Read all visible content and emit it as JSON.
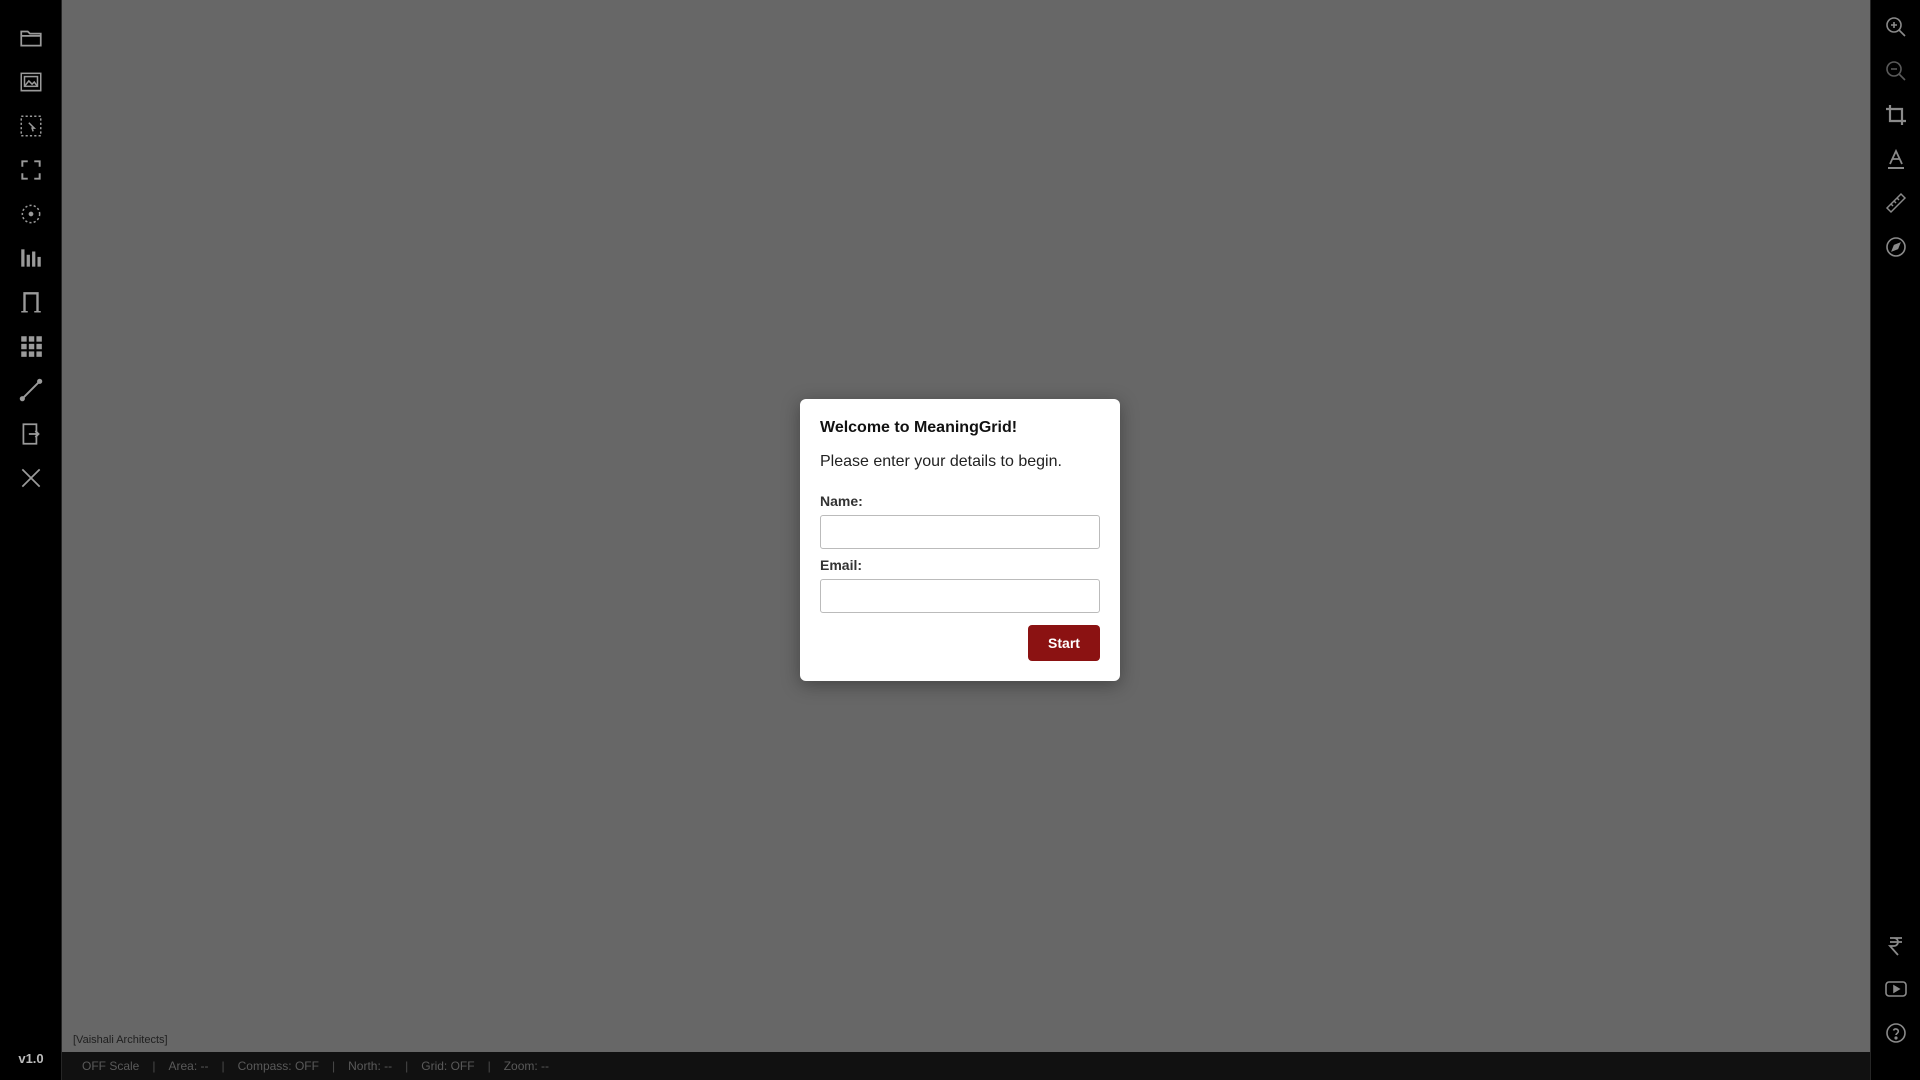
{
  "app": {
    "version": "v1.0"
  },
  "left_tools": [
    {
      "name": "open-folder-icon"
    },
    {
      "name": "gallery-icon"
    },
    {
      "name": "select-region-icon"
    },
    {
      "name": "fullscreen-icon"
    },
    {
      "name": "target-icon"
    },
    {
      "name": "bar-chart-icon"
    },
    {
      "name": "doorway-icon"
    },
    {
      "name": "grid-icon"
    },
    {
      "name": "line-tool-icon"
    },
    {
      "name": "export-icon"
    },
    {
      "name": "close-icon"
    }
  ],
  "right_tools_top": [
    {
      "name": "zoom-in-icon"
    },
    {
      "name": "zoom-out-icon"
    },
    {
      "name": "crop-icon"
    },
    {
      "name": "text-icon"
    },
    {
      "name": "ruler-icon"
    },
    {
      "name": "compass-icon"
    }
  ],
  "right_tools_bottom": [
    {
      "name": "rupee-icon"
    },
    {
      "name": "youtube-icon"
    },
    {
      "name": "help-icon"
    }
  ],
  "canvas": {
    "credit": "[Vaishali Architects]"
  },
  "status_bar": {
    "scale": "OFF Scale",
    "area": "Area: --",
    "compass": "Compass: OFF",
    "north": "North: --",
    "grid": "Grid: OFF",
    "zoom": "Zoom: --",
    "separator": "|"
  },
  "modal": {
    "title": "Welcome to MeaningGrid!",
    "subtitle": "Please enter your details to begin.",
    "name_label": "Name:",
    "name_value": "",
    "email_label": "Email:",
    "email_value": "",
    "start_label": "Start"
  },
  "colors": {
    "canvas": "#676767",
    "accent": "#8b1212",
    "toolbar": "#000000"
  }
}
